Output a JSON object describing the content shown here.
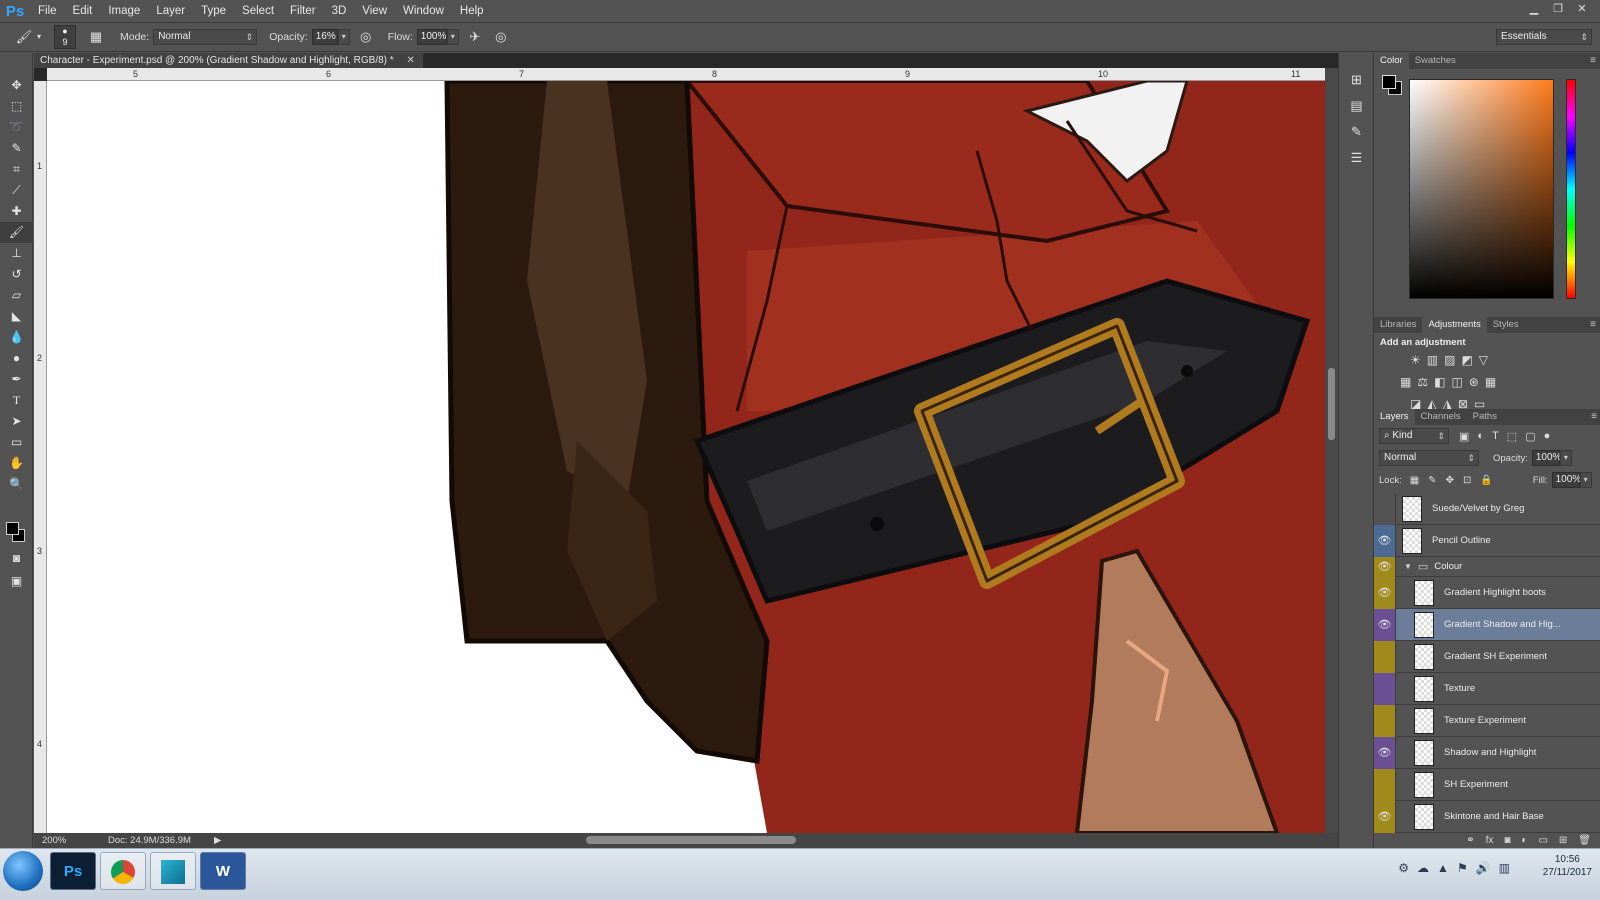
{
  "app": {
    "logo": "Ps"
  },
  "menu": [
    "File",
    "Edit",
    "Image",
    "Layer",
    "Type",
    "Select",
    "Filter",
    "3D",
    "View",
    "Window",
    "Help"
  ],
  "options_bar": {
    "brush_size": "9",
    "mode_label": "Mode:",
    "mode_value": "Normal",
    "opacity_label": "Opacity:",
    "opacity_value": "16%",
    "flow_label": "Flow:",
    "flow_value": "100%",
    "workspace": "Essentials"
  },
  "document": {
    "tab_title": "Character - Experiment.psd @ 200% (Gradient Shadow and Highlight, RGB/8) *",
    "ruler_h": [
      "5",
      "6",
      "7",
      "8",
      "9",
      "10",
      "11"
    ],
    "ruler_v": [
      "1",
      "2",
      "3",
      "4"
    ],
    "zoom": "200%",
    "doc_size": "Doc: 24.9M/336.9M"
  },
  "color_panel": {
    "tabs": [
      "Color",
      "Swatches"
    ],
    "foreground": "#000000",
    "background": "#000000"
  },
  "adjustments_panel": {
    "tabs": [
      "Libraries",
      "Adjustments",
      "Styles"
    ],
    "heading": "Add an adjustment"
  },
  "layers_panel": {
    "tabs": [
      "Layers",
      "Channels",
      "Paths"
    ],
    "filter_kind": "Kind",
    "blend_mode": "Normal",
    "opacity_label": "Opacity:",
    "opacity_value": "100%",
    "lock_label": "Lock:",
    "fill_label": "Fill:",
    "fill_value": "100%",
    "layers": [
      {
        "name": "Suede/Velvet by Greg",
        "visible": false,
        "tag": "none",
        "indent": false
      },
      {
        "name": "Pencil Outline",
        "visible": true,
        "tag": "blue",
        "indent": false
      },
      {
        "name": "Colour",
        "visible": true,
        "tag": "yellow",
        "indent": false,
        "group": true
      },
      {
        "name": "Gradient Highlight boots",
        "visible": true,
        "tag": "yellow",
        "indent": true
      },
      {
        "name": "Gradient Shadow and Hig...",
        "visible": true,
        "tag": "violet",
        "indent": true,
        "selected": true
      },
      {
        "name": "Gradient SH Experiment",
        "visible": false,
        "tag": "yellow",
        "indent": true
      },
      {
        "name": "Texture",
        "visible": false,
        "tag": "violet",
        "indent": true
      },
      {
        "name": "Texture Experiment",
        "visible": false,
        "tag": "yellow",
        "indent": true
      },
      {
        "name": "Shadow and Highlight",
        "visible": true,
        "tag": "violet",
        "indent": true
      },
      {
        "name": "SH Experiment",
        "visible": false,
        "tag": "yellow",
        "indent": true
      },
      {
        "name": "Skintone and Hair Base",
        "visible": true,
        "tag": "yellow",
        "indent": true
      }
    ]
  },
  "taskbar": {
    "apps": [
      "Ps",
      "Chrome",
      "App",
      "W"
    ],
    "time": "10:56",
    "date": "27/11/2017"
  },
  "colors": {
    "ui_bg": "#535353",
    "selected_layer": "#6c7d99",
    "tag_blue": "#4d6a94",
    "tag_yellow": "#a08a1c",
    "tag_violet": "#6a4f94"
  }
}
